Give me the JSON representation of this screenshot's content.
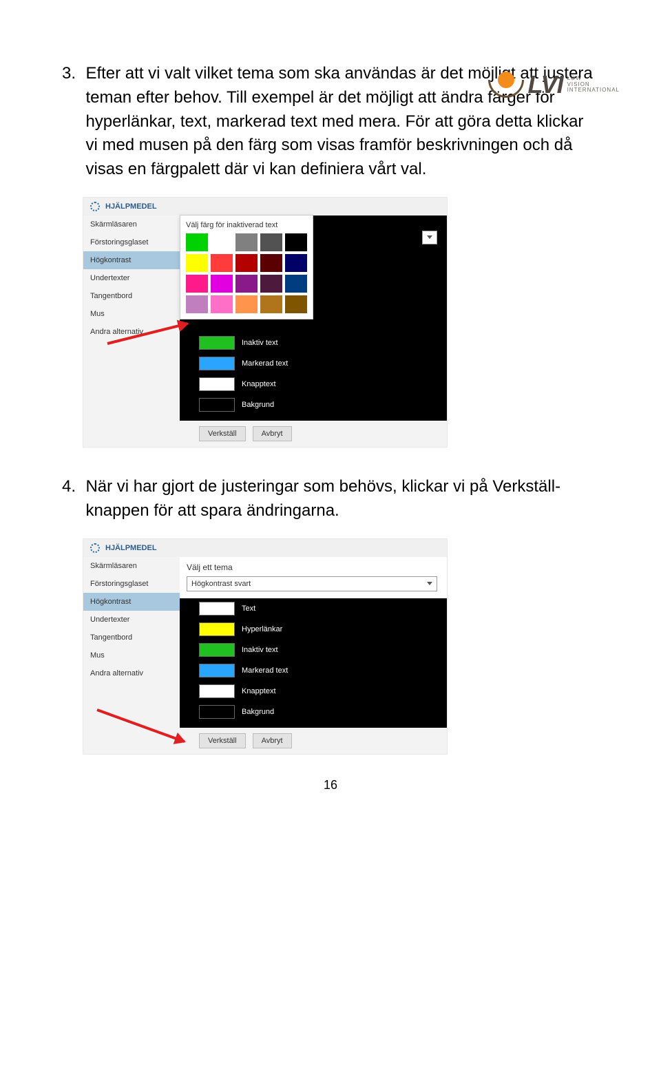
{
  "logo": {
    "brand": "LVI",
    "sub1": "LOW",
    "sub2": "VISION",
    "sub3": "INTERNATIONAL"
  },
  "para3": {
    "num": "3.",
    "text": "Efter att vi valt vilket tema som ska användas är det möjligt att justera teman efter behov. Till exempel är det möjligt att ändra färger för hyperlänkar, text, markerad text med mera. För att göra detta klickar vi med musen på den färg som visas framför beskrivningen och då visas en färgpalett där vi kan definiera vårt val."
  },
  "para4": {
    "num": "4.",
    "text": "När vi har gjort de justeringar som behövs, klickar vi på Verkställ-knappen för att spara ändringarna."
  },
  "shot": {
    "hdr": "HJÄLPMEDEL",
    "side": [
      "Skärmläsaren",
      "Förstoringsglaset",
      "Högkontrast",
      "Undertexter",
      "Tangentbord",
      "Mus",
      "Andra alternativ"
    ],
    "popup_label": "Välj färg för inaktiverad text",
    "choose_label": "Välj ett tema",
    "dropdown_value": "Högkontrast svart",
    "rows": {
      "text": "Text",
      "hyper": "Hyperlänkar",
      "inactive": "Inaktiv text",
      "marked": "Markerad text",
      "button": "Knapptext",
      "bg": "Bakgrund"
    },
    "btn_apply": "Verkställ",
    "btn_cancel": "Avbryt"
  },
  "colors": {
    "popup_grid": [
      "#00d100",
      "#ffffff",
      "#808080",
      "#525252",
      "#000000",
      "#ffff00",
      "#ff3b3b",
      "#b30000",
      "#5a0000",
      "#000066",
      "#ff1a8c",
      "#e000e0",
      "#8a1a8a",
      "#4d1a3d",
      "#003d80",
      "#c080c0",
      "#ff6ec7",
      "#ff944d",
      "#b0751a",
      "#805500"
    ],
    "row_text": "#ffffff",
    "row_hyper": "#ffff00",
    "row_inactive": "#20c020",
    "row_marked": "#2aa5ff",
    "row_button": "#ffffff",
    "row_bg": "#000000"
  },
  "pagenum": "16"
}
